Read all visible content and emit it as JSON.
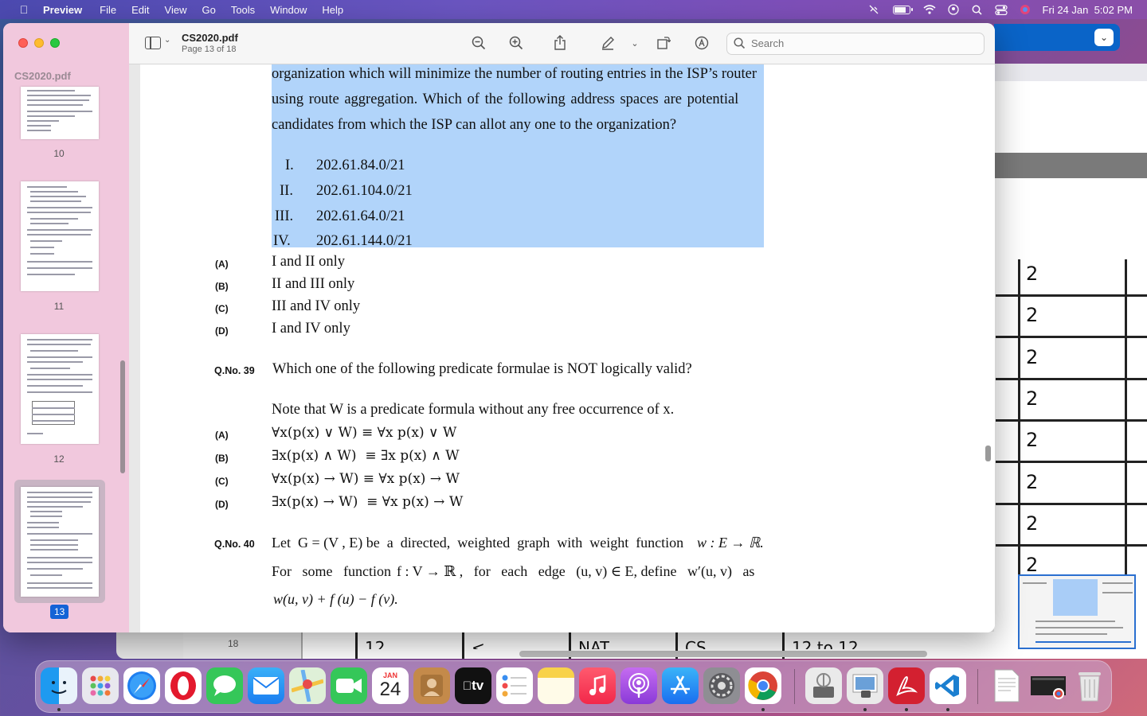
{
  "menubar": {
    "app_name": "Preview",
    "items": [
      "File",
      "Edit",
      "View",
      "Go",
      "Tools",
      "Window",
      "Help"
    ],
    "datetime": "Fri 24 Jan  5:02 PM",
    "battery_level": 0.8
  },
  "window": {
    "title": "CS2020.pdf",
    "subtitle": "Page 13 of 18",
    "search_placeholder": "Search"
  },
  "sidebar": {
    "title": "CS2020.pdf",
    "pages": [
      "10",
      "11",
      "12",
      "13"
    ],
    "current_page": "13"
  },
  "document": {
    "question_38_tail": [
      "organization which will minimize the number of routing entries in the ISP’s router",
      "using route aggregation. Which of the following address spaces are potential",
      "candidates from which the ISP can allot any one to the organization?"
    ],
    "roman_items": [
      {
        "num": "I.",
        "addr": "202.61.84.0/21"
      },
      {
        "num": "II.",
        "addr": "202.61.104.0/21"
      },
      {
        "num": "III.",
        "addr": "202.61.64.0/21"
      },
      {
        "num": "IV.",
        "addr": "202.61.144.0/21"
      }
    ],
    "q38_options": [
      {
        "label": "(A)",
        "text": "I and II only"
      },
      {
        "label": "(B)",
        "text": "II and III only"
      },
      {
        "label": "(C)",
        "text": "III and IV only"
      },
      {
        "label": "(D)",
        "text": "I and IV only"
      }
    ],
    "q39": {
      "number": "Q.No. 39",
      "text": "Which one of the following predicate formulae is NOT logically valid?",
      "note": "Note that W is a predicate formula without any free occurrence of x.",
      "options": [
        {
          "label": "(A)",
          "text": "∀x(p(x) ∨ W) ≡ ∀x p(x) ∨ W"
        },
        {
          "label": "(B)",
          "text": "∃x(p(x) ∧ W)  ≡ ∃x p(x) ∧ W"
        },
        {
          "label": "(C)",
          "text": "∀x(p(x) → W) ≡ ∀x p(x) → W"
        },
        {
          "label": "(D)",
          "text": "∃x(p(x) → W)  ≡ ∀x p(x) → W"
        }
      ]
    },
    "q40": {
      "number": "Q.No. 40",
      "line1_a": "Let  G = (V , E) be  a  directed,  weighted  graph  with  weight  function",
      "line1_b": "w : E → ℝ.",
      "line2_a": "For   some   function",
      "line2_b": "f : V → ℝ ,   for   each   edge   (u, v) ∈ E, define   w′(u, v)   as",
      "line3": "w(u, v) + f (u) − f (v)."
    }
  },
  "background_window": {
    "table_values": [
      "2",
      "2",
      "2",
      "2",
      "2",
      "2",
      "2",
      "2"
    ],
    "ruler_number": "18",
    "bottom_partials": [
      "12",
      "<",
      "NAT",
      "CS",
      "12 to 12"
    ]
  },
  "dock": {
    "calendar_month": "JAN",
    "calendar_day": "24",
    "tv_label": "tv"
  }
}
